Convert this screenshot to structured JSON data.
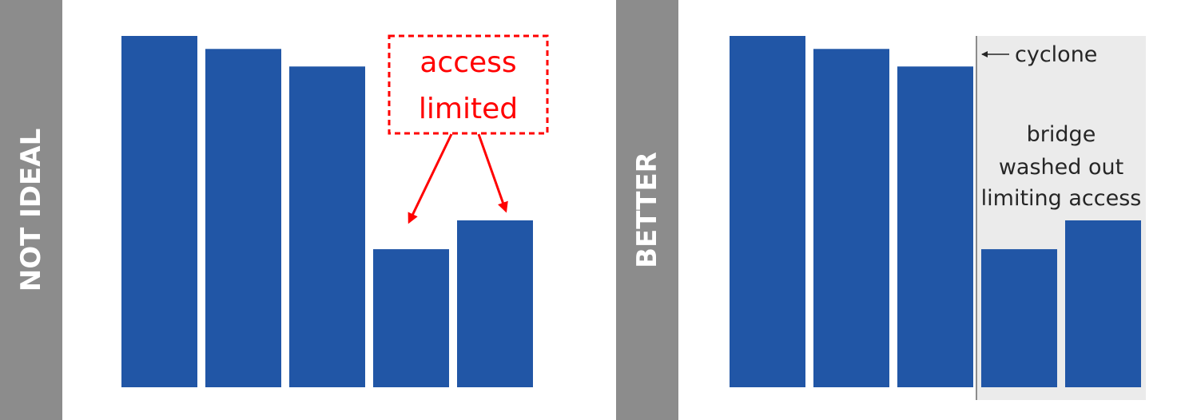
{
  "colors": {
    "bar": "#2156a6",
    "band": "#8c8c8c",
    "highlight_region": "#ebebeb",
    "cyclone_line": "#8c8c8c",
    "alert": "#ff0000",
    "annotation_text": "#262626"
  },
  "panels": [
    {
      "label": "NOT IDEAL",
      "annotation": {
        "lines": [
          "access",
          "limited"
        ],
        "style": "dashed red box with arrows to bars 4 and 5"
      }
    },
    {
      "label": "BETTER",
      "marker_label": "cyclone",
      "region_note": [
        "bridge",
        "washed out",
        "limiting access"
      ]
    }
  ],
  "chart_data": [
    {
      "type": "bar",
      "categories": [
        "1",
        "2",
        "3",
        "4",
        "5"
      ],
      "values": [
        100,
        96.3,
        91.3,
        39.3,
        47.5
      ],
      "title": "",
      "xlabel": "",
      "ylabel": "",
      "ylim": [
        0,
        100
      ],
      "grid": false,
      "axes_visible": false,
      "annotations": [
        "access limited"
      ]
    },
    {
      "type": "bar",
      "categories": [
        "1",
        "2",
        "3",
        "4",
        "5"
      ],
      "values": [
        100,
        96.3,
        91.3,
        39.3,
        47.5
      ],
      "title": "",
      "xlabel": "",
      "ylabel": "",
      "ylim": [
        0,
        100
      ],
      "grid": false,
      "axes_visible": false,
      "event_marker": {
        "label": "cyclone",
        "between_categories": [
          "3",
          "4"
        ]
      },
      "shaded_region": {
        "from_category": "4",
        "to_category": "5",
        "note": "bridge washed out limiting access"
      }
    }
  ]
}
